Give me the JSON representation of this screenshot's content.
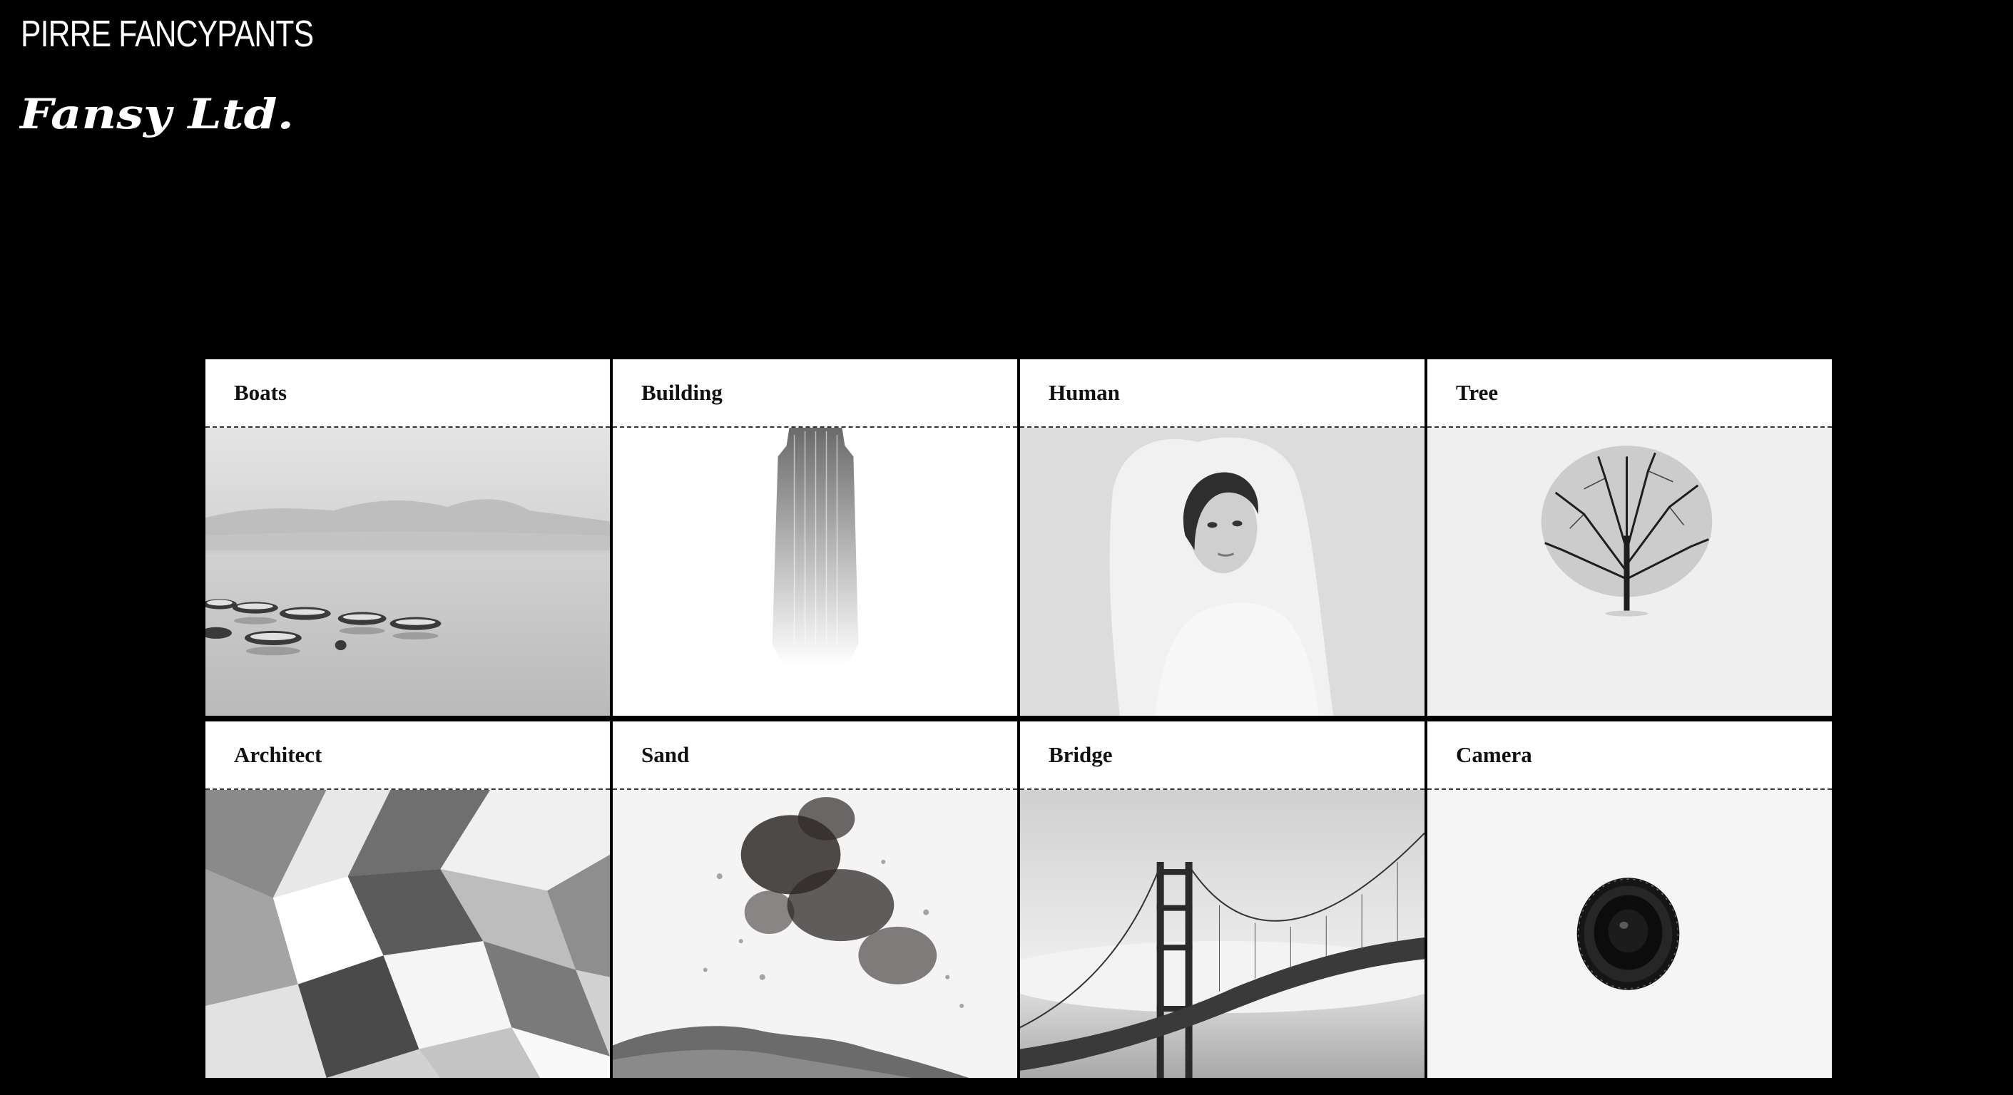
{
  "header": {
    "site_name": "PIRRE FANCYPANTS",
    "logo_text": "Fansy Ltd."
  },
  "gallery": {
    "cards": [
      {
        "label": "Boats"
      },
      {
        "label": "Building"
      },
      {
        "label": "Human"
      },
      {
        "label": "Tree"
      },
      {
        "label": "Architect"
      },
      {
        "label": "Sand"
      },
      {
        "label": "Bridge"
      },
      {
        "label": "Camera"
      }
    ]
  },
  "colors": {
    "page_background": "#000000",
    "card_background": "#ffffff",
    "text_light": "#ffffff",
    "text_dark": "#111111"
  }
}
